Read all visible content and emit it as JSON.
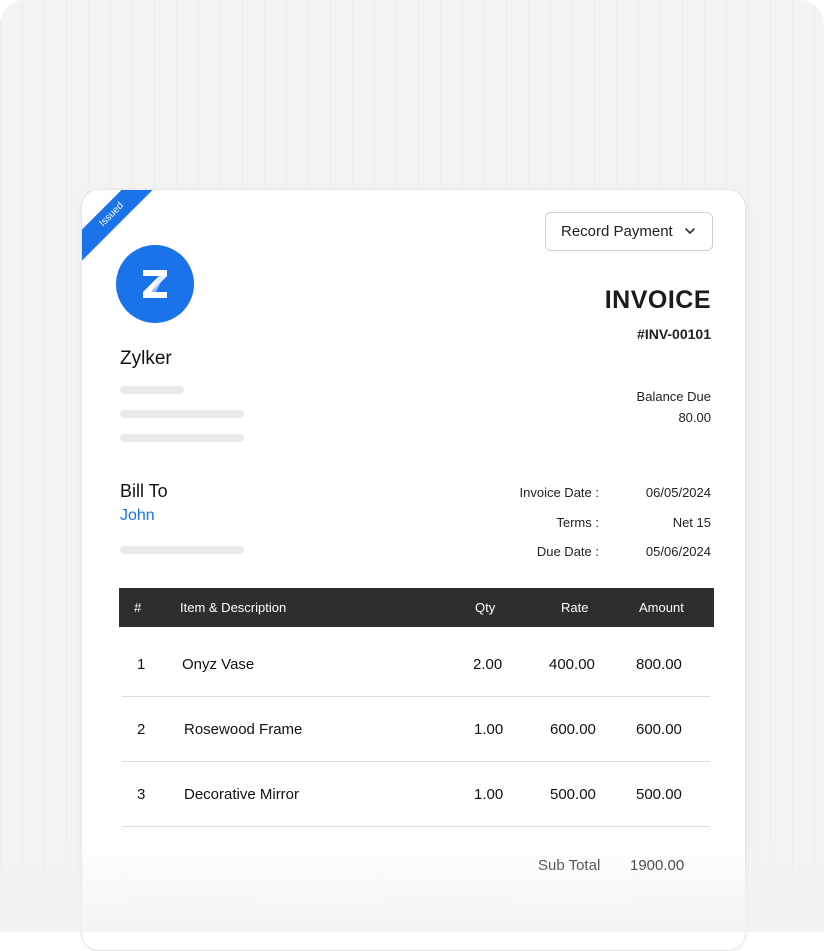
{
  "ribbon": {
    "label": "Issued"
  },
  "toolbar": {
    "record_payment_label": "Record Payment"
  },
  "company": {
    "name": "Zylker",
    "logo_letter": "Z"
  },
  "invoice": {
    "title": "INVOICE",
    "number": "#INV-00101",
    "balance_due_label": "Balance Due",
    "balance_due_value": "80.00"
  },
  "bill_to": {
    "label": "Bill To",
    "client_name": "John"
  },
  "meta": [
    {
      "label": "Invoice Date :",
      "value": "06/05/2024"
    },
    {
      "label": "Terms :",
      "value": "Net 15"
    },
    {
      "label": "Due Date :",
      "value": "05/06/2024"
    }
  ],
  "table": {
    "headers": {
      "num": "#",
      "item": "Item & Description",
      "qty": "Qty",
      "rate": "Rate",
      "amount": "Amount"
    },
    "rows": [
      {
        "num": "1",
        "item": "Onyz Vase",
        "qty": "2.00",
        "rate": "400.00",
        "amount": "800.00"
      },
      {
        "num": "2",
        "item": "Rosewood Frame",
        "qty": "1.00",
        "rate": "600.00",
        "amount": "600.00"
      },
      {
        "num": "3",
        "item": "Decorative Mirror",
        "qty": "1.00",
        "rate": "500.00",
        "amount": "500.00"
      }
    ]
  },
  "totals": {
    "subtotal_label": "Sub Total",
    "subtotal_value": "1900.00"
  },
  "colors": {
    "accent": "#1a73e8",
    "table_header": "#2e2e2e"
  }
}
